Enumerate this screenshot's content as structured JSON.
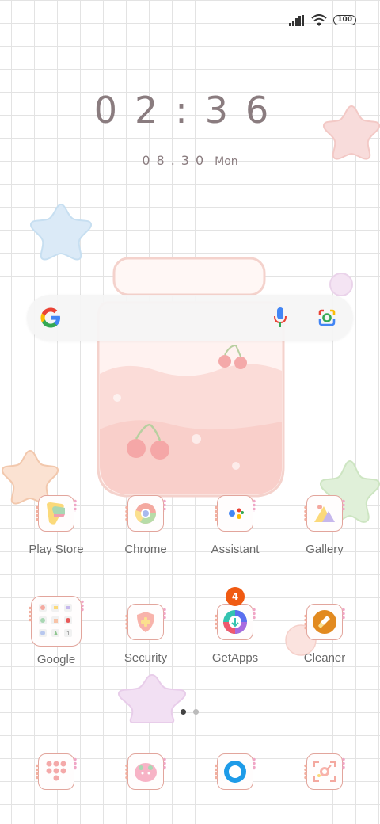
{
  "status_bar": {
    "battery": "100",
    "signal_icon": "signal-icon",
    "wifi_icon": "wifi-icon"
  },
  "clock": {
    "time": "02:36",
    "date": "08.30",
    "weekday": "Mon"
  },
  "search": {
    "google_icon": "google-g-icon",
    "mic_icon": "mic-icon",
    "lens_icon": "google-lens-icon"
  },
  "apps_row1": [
    {
      "label": "Play Store",
      "icon": "play-store-icon"
    },
    {
      "label": "Chrome",
      "icon": "chrome-icon"
    },
    {
      "label": "Assistant",
      "icon": "assistant-icon"
    },
    {
      "label": "Gallery",
      "icon": "gallery-icon"
    }
  ],
  "apps_row2": [
    {
      "label": "Google",
      "icon": "google-folder-icon"
    },
    {
      "label": "Security",
      "icon": "security-icon"
    },
    {
      "label": "GetApps",
      "icon": "getapps-icon",
      "badge": "4"
    },
    {
      "label": "Cleaner",
      "icon": "cleaner-icon"
    }
  ],
  "page_indicator": {
    "pages": 2,
    "current": 1
  },
  "dock": [
    {
      "icon": "phone-dialer-icon"
    },
    {
      "icon": "messages-icon"
    },
    {
      "icon": "browser-icon"
    },
    {
      "icon": "camera-icon"
    }
  ],
  "colors": {
    "accent": "#e2a59c",
    "badge": "#f05a12",
    "text": "#6a6a6a"
  }
}
